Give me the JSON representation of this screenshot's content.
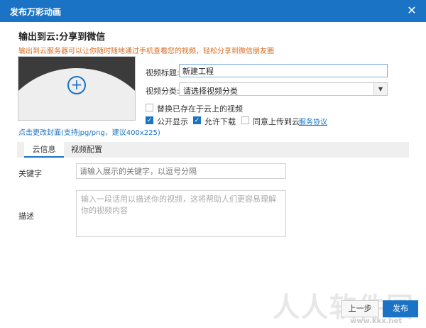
{
  "window": {
    "title": "发布万彩动画",
    "close_glyph": "✕"
  },
  "header": {
    "title": "输出到云:分享到微信",
    "subtitle": "输出到云服务器可以让你随时随地通过手机查看您的视频，轻松分享到微信朋友圈"
  },
  "cover": {
    "change_link": "点击更改封面(支持jpg/png，建议400x225)"
  },
  "form": {
    "title_label": "视频标题:",
    "title_value": "新建工程",
    "category_label": "视频分类:",
    "category_value": "请选择视频分类",
    "replace_cloud_label": "替换已存在于云上的视频",
    "public_label": "公开显示",
    "allow_download_label": "允许下载",
    "agree_upload_label": "同意上传到云",
    "service_link": "服务协议"
  },
  "tabs": [
    {
      "label": "云信息"
    },
    {
      "label": "视频配置"
    }
  ],
  "cloud_info": {
    "keyword_label": "关键字",
    "keyword_placeholder": "请输入展示的关键字，以逗号分隔",
    "description_label": "描述",
    "description_placeholder": "输入一段话用以描述你的视频，这将帮助人们更容易理解你的视频内容"
  },
  "footer": {
    "prev_label": "上一步",
    "publish_label": "发布"
  },
  "watermark": {
    "text": "人人软件园",
    "url": "www.kkx.net"
  },
  "colors": {
    "accent": "#1a73c4",
    "subtitle": "#d86a1e"
  }
}
